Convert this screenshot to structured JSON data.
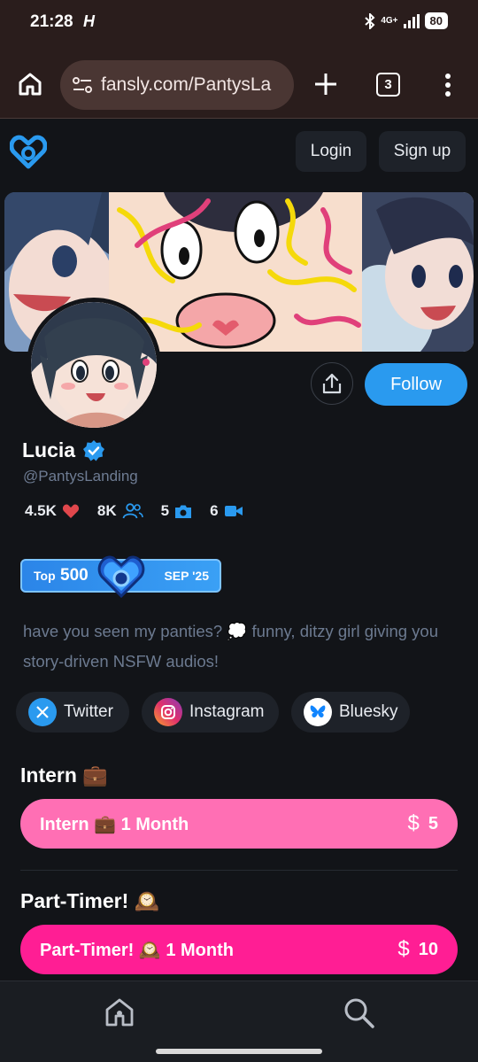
{
  "status_bar": {
    "time": "21:28",
    "carrier_glyph": "H",
    "network": "4G+",
    "battery": "80"
  },
  "browser": {
    "url": "fansly.com/PantysLa",
    "tab_count": "3"
  },
  "header": {
    "login_label": "Login",
    "signup_label": "Sign up"
  },
  "profile": {
    "name": "Lucia",
    "handle": "@PantysLanding",
    "follow_label": "Follow",
    "stats": {
      "likes": "4.5K",
      "followers": "8K",
      "photos": "5",
      "videos": "6"
    },
    "badge": {
      "prefix": "Top",
      "rank": "500",
      "date": "SEP '25"
    },
    "bio": "have you seen my panties? 💭 funny, ditzy girl giving you story-driven NSFW audios!"
  },
  "socials": [
    {
      "label": "Twitter",
      "icon": "x-icon"
    },
    {
      "label": "Instagram",
      "icon": "instagram-icon"
    },
    {
      "label": "Bluesky",
      "icon": "bluesky-icon"
    }
  ],
  "tiers": [
    {
      "title": "Intern 💼",
      "button_label": "Intern 💼 1 Month",
      "price": "5",
      "color": "#ff6fb4"
    },
    {
      "title": "Part-Timer! 🕰️",
      "button_label": "Part-Timer! 🕰️ 1 Month",
      "price": "10",
      "color": "#ff1e94"
    }
  ],
  "colors": {
    "accent": "#2a9aef",
    "background": "#121418",
    "heart": "#e0474c"
  }
}
